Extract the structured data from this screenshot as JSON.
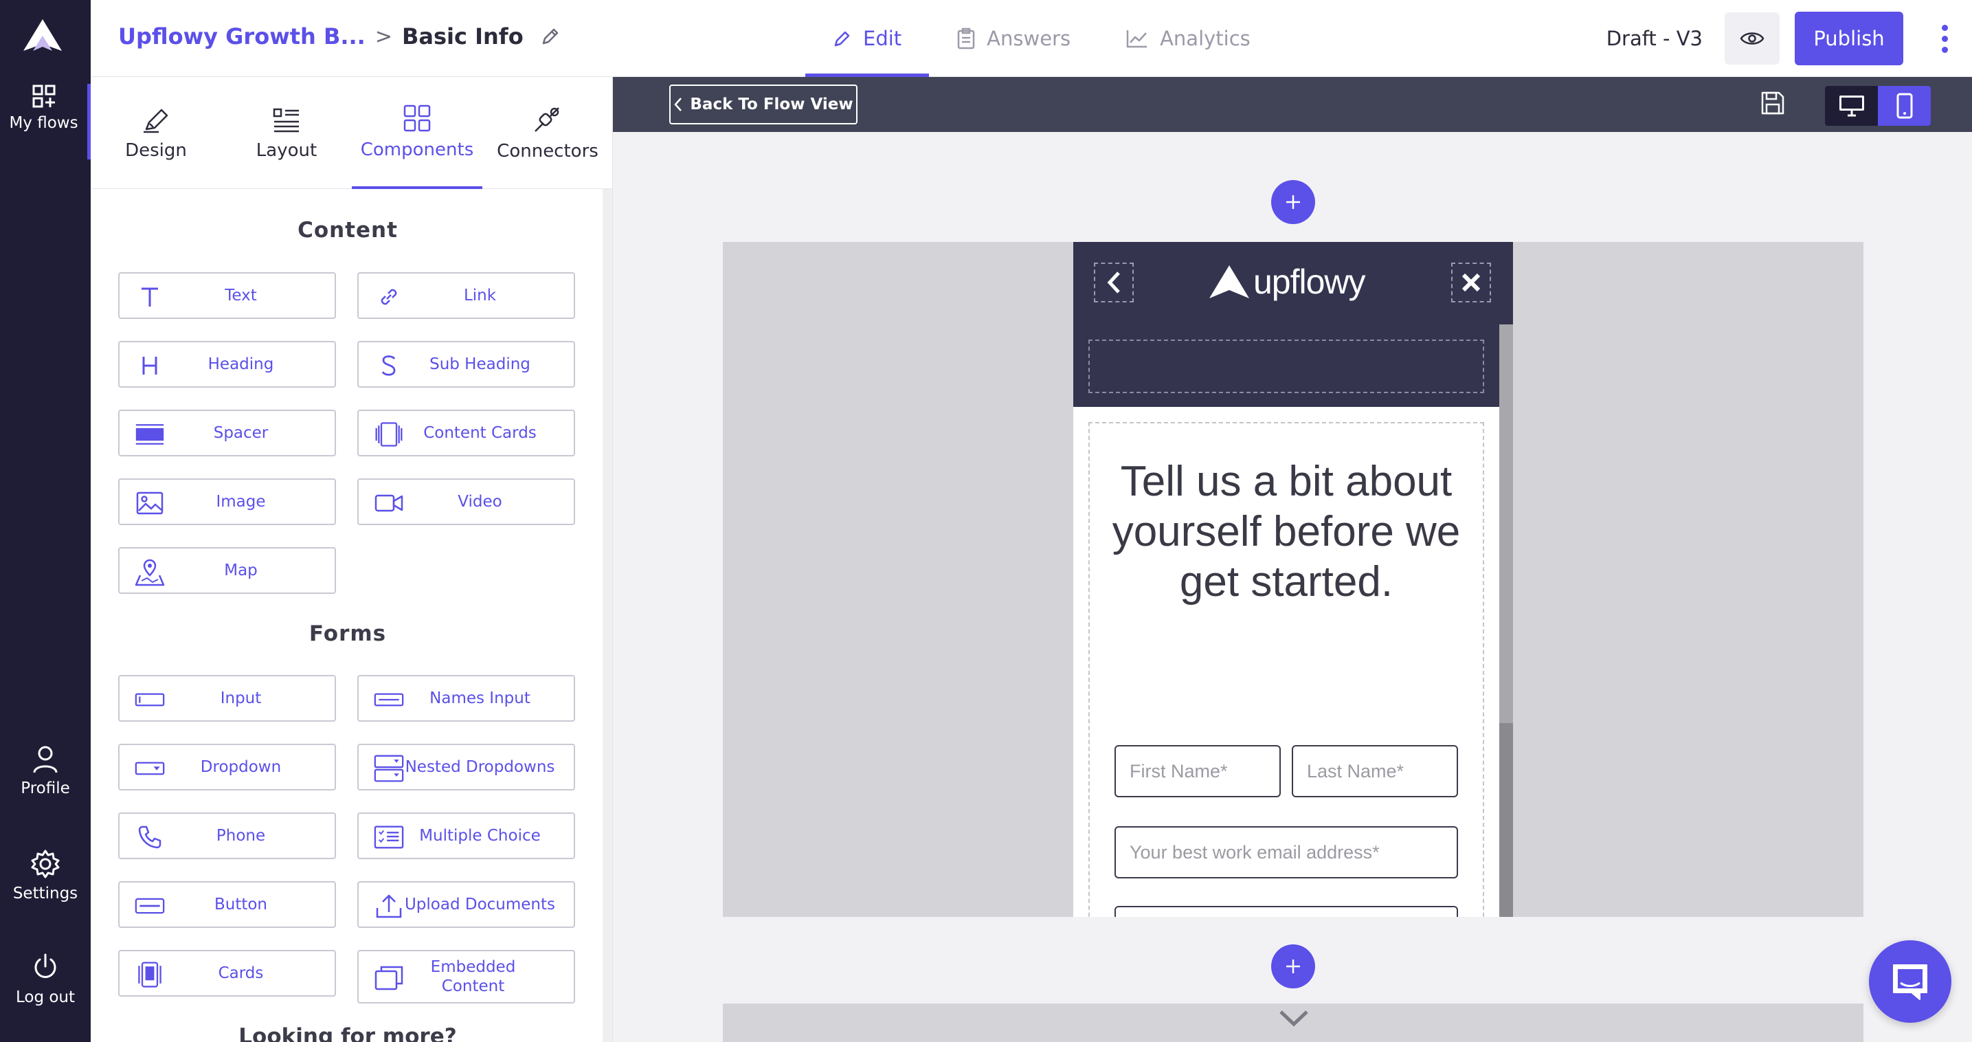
{
  "rail": {
    "my_flows": "My flows",
    "profile": "Profile",
    "settings": "Settings",
    "logout": "Log out"
  },
  "header": {
    "flow_name": "Upflowy Growth B...",
    "separator": ">",
    "page_name": "Basic Info",
    "tabs": [
      {
        "label": "Edit",
        "icon": "pencil-icon",
        "active": true
      },
      {
        "label": "Answers",
        "icon": "clipboard-icon",
        "active": false
      },
      {
        "label": "Analytics",
        "icon": "line-chart-icon",
        "active": false
      }
    ],
    "draft": "Draft - V3",
    "publish": "Publish"
  },
  "panel": {
    "tabs": [
      {
        "label": "Design",
        "icon": "brush-icon"
      },
      {
        "label": "Layout",
        "icon": "layout-icon"
      },
      {
        "label": "Components",
        "icon": "grid-icon",
        "active": true
      },
      {
        "label": "Connectors",
        "icon": "plug-icon"
      }
    ],
    "content_title": "Content",
    "content_items": [
      {
        "label": "Text",
        "icon": "text-icon"
      },
      {
        "label": "Link",
        "icon": "link-icon"
      },
      {
        "label": "Heading",
        "icon": "heading-icon"
      },
      {
        "label": "Sub Heading",
        "icon": "subheading-icon"
      },
      {
        "label": "Spacer",
        "icon": "spacer-icon"
      },
      {
        "label": "Content Cards",
        "icon": "content-cards-icon"
      },
      {
        "label": "Image",
        "icon": "image-icon"
      },
      {
        "label": "Video",
        "icon": "video-icon"
      },
      {
        "label": "Map",
        "icon": "map-icon"
      }
    ],
    "forms_title": "Forms",
    "forms_items": [
      {
        "label": "Input",
        "icon": "input-icon"
      },
      {
        "label": "Names Input",
        "icon": "names-input-icon"
      },
      {
        "label": "Dropdown",
        "icon": "dropdown-icon"
      },
      {
        "label": "Nested Dropdowns",
        "icon": "nested-dropdowns-icon"
      },
      {
        "label": "Phone",
        "icon": "phone-icon"
      },
      {
        "label": "Multiple Choice",
        "icon": "multiple-choice-icon"
      },
      {
        "label": "Button",
        "icon": "button-icon"
      },
      {
        "label": "Upload Documents",
        "icon": "upload-icon"
      },
      {
        "label": "Cards",
        "icon": "cards-icon"
      },
      {
        "label": "Embedded Content",
        "icon": "embed-icon"
      }
    ],
    "more_title": "Looking for more?"
  },
  "canvas": {
    "back_button": "Back To Flow View",
    "preview": {
      "logo_text": "upflowy",
      "title": "Tell us a bit about yourself before we get started.",
      "first_name_placeholder": "First Name*",
      "last_name_placeholder": "Last Name*",
      "email_placeholder": "Your best work email address*"
    }
  },
  "colors": {
    "accent": "#5b50e8",
    "rail_bg": "#1f1d36",
    "preview_header": "#34344f",
    "canvas_bar": "#414456"
  }
}
